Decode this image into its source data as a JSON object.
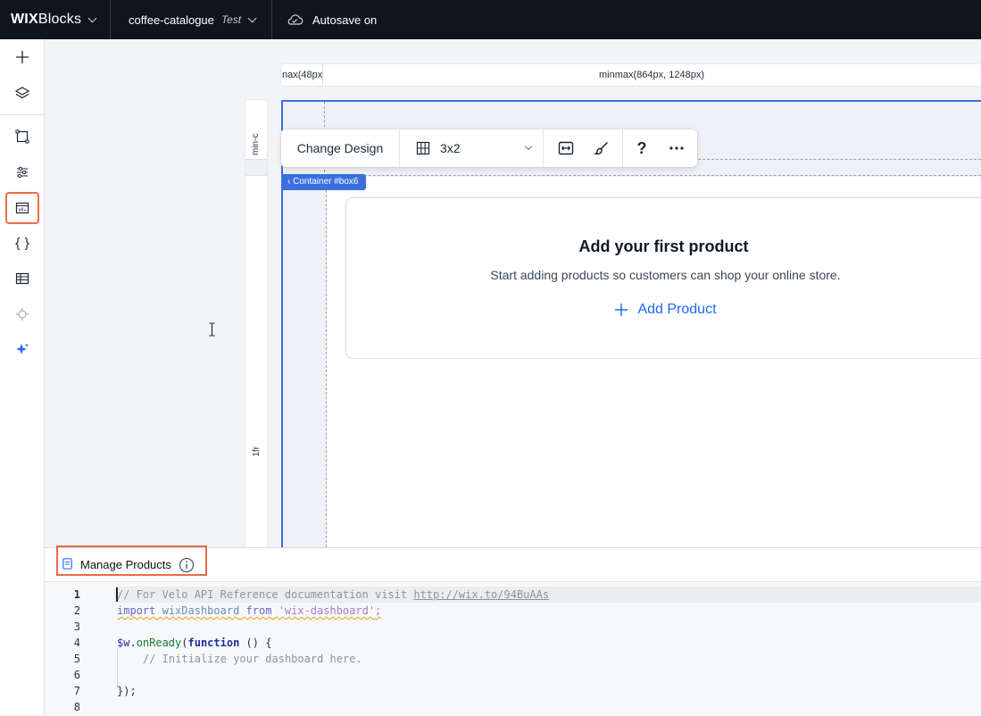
{
  "topbar": {
    "logo_brand": "WIX",
    "logo_product": "Blocks",
    "site_name": "coffee-catalogue",
    "site_tag": "Test",
    "autosave_label": "Autosave on"
  },
  "leftbar": {
    "items": [
      {
        "icon": "plus-icon"
      },
      {
        "icon": "layers-icon"
      },
      {
        "icon": "crop-icon"
      },
      {
        "icon": "sliders-icon"
      },
      {
        "icon": "dashboard-page-icon",
        "active": true
      },
      {
        "icon": "code-braces-icon"
      },
      {
        "icon": "table-icon"
      },
      {
        "icon": "connect-icon"
      },
      {
        "icon": "ai-sparkle-icon"
      }
    ]
  },
  "canvas": {
    "column_ruler": [
      "nax(48px",
      "minmax(864px, 1248px)"
    ],
    "row_ruler": [
      "min-c",
      "1fr"
    ],
    "container_tag": "Container #box6",
    "toolbar": {
      "change_design": "Change Design",
      "layout_value": "3x2"
    },
    "empty_state": {
      "title": "Add your first product",
      "subtitle": "Start adding products so customers can shop your online store.",
      "action": "Add Product"
    }
  },
  "code_panel": {
    "tab_title": "Manage Products",
    "line_numbers": [
      "1",
      "2",
      "3",
      "4",
      "5",
      "6",
      "7",
      "8"
    ],
    "comment1": "// For Velo API Reference documentation visit ",
    "comment1_url": "http://wix.to/94BuAAs",
    "import_kw": "import",
    "import_id": "wixDashboard",
    "from_kw": "from",
    "import_str": "'wix-dashboard'",
    "semicolon": ";",
    "onready_obj": "$w",
    "onready_dot": ".",
    "onready_fn": "onReady",
    "onready_open": "(",
    "function_kw": "function",
    "function_tail": " () {",
    "comment2": "// Initialize your dashboard here.",
    "close": "});",
    "accent": "#ea6a4d",
    "selection_color": "#3b6fe0"
  }
}
